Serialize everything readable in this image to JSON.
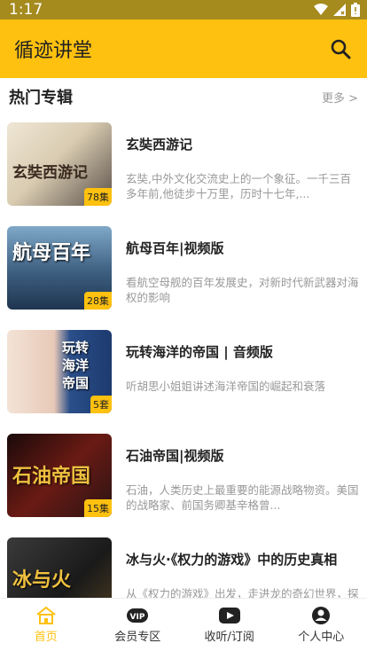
{
  "status_bar": {
    "time": "1:17"
  },
  "app_bar": {
    "title": "循迹讲堂"
  },
  "section": {
    "title": "热门专辑",
    "more": "更多 >"
  },
  "items": [
    {
      "title": "玄奘西游记",
      "desc": "玄奘,中外文化交流史上的一个象征。一千三百多年前,他徒步十万里，历时十七年,...",
      "badge": "78集",
      "thumb_text": "玄奘西游记",
      "thumb_color": "#5a5048"
    },
    {
      "title": "航母百年|视频版",
      "desc": "看航空母舰的百年发展史，对新时代新武器对海权的影响",
      "badge": "28集",
      "thumb_text": "航母百年",
      "thumb_color": "#2f4a6a"
    },
    {
      "title": "玩转海洋的帝国 | 音频版",
      "desc": "听胡思小姐姐讲述海洋帝国的崛起和衰落",
      "badge": "5套",
      "thumb_text": "玩转海洋帝国",
      "thumb_color": "#2a4f8a"
    },
    {
      "title": "石油帝国|视频版",
      "desc": "石油，人类历史上最重要的能源战略物资。美国的战略家、前国务卿基辛格曾...",
      "badge": "15集",
      "thumb_text": "石油帝国",
      "thumb_color": "#3a1a18"
    },
    {
      "title": "冰与火·《权力的游戏》中的历史真相",
      "desc": "从《权力的游戏》出发，走进龙的奇幻世界，探索背后的历史真相",
      "badge": "",
      "thumb_text": "冰与火",
      "thumb_color": "#2a2a2a"
    }
  ],
  "tabs": [
    {
      "label": "首页",
      "icon": "home-icon",
      "active": true
    },
    {
      "label": "会员专区",
      "icon": "vip-icon",
      "active": false
    },
    {
      "label": "收听/订阅",
      "icon": "play-icon",
      "active": false
    },
    {
      "label": "个人中心",
      "icon": "user-icon",
      "active": false
    }
  ],
  "colors": {
    "accent": "#fec10f",
    "status_bar": "#a58a1e",
    "muted": "#999999"
  }
}
